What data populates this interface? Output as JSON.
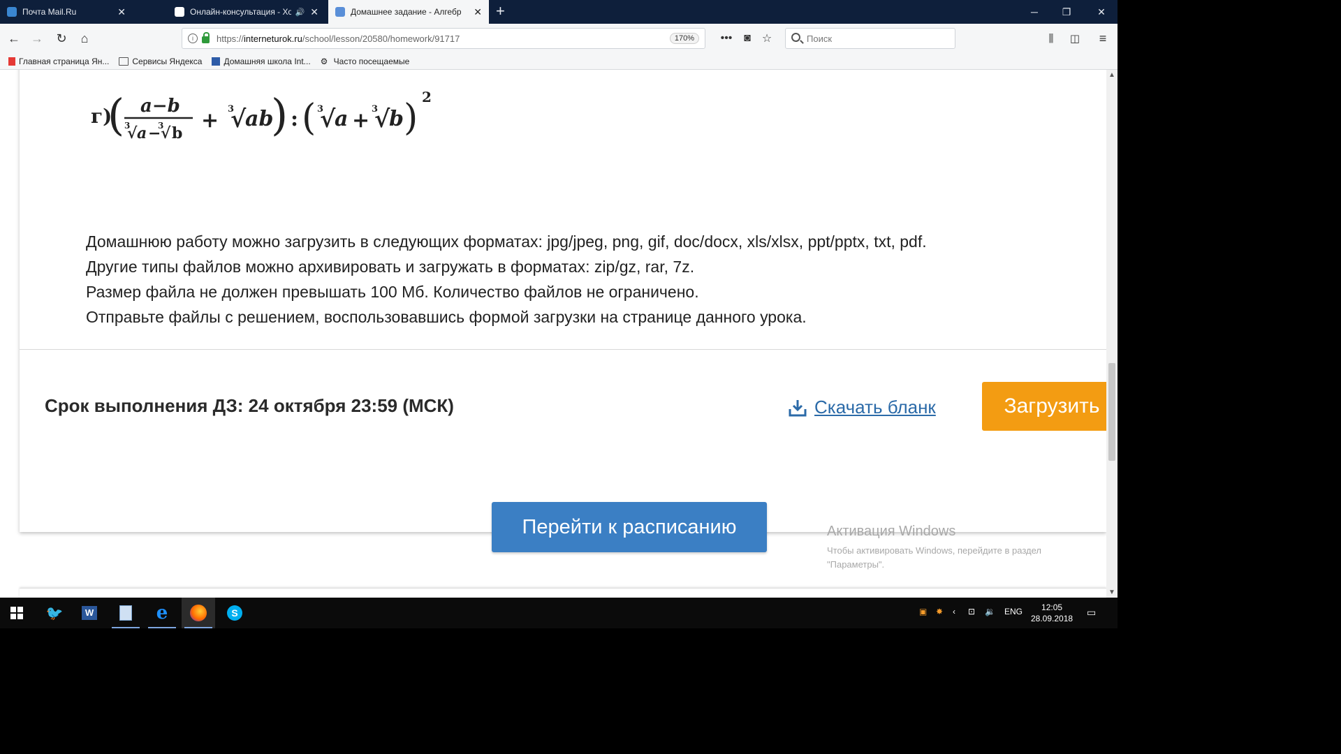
{
  "tabs": [
    {
      "title": "Почта Mail.Ru",
      "color": "#3a86d1"
    },
    {
      "title": "Онлайн-консультация - Хо",
      "color": "#ffffff"
    },
    {
      "title": "Домашнее задание - Алгебр",
      "color": "#5a8fd8"
    }
  ],
  "address": {
    "scheme": "https://",
    "host": "interneturok.ru",
    "path": "/school/lesson/20580/homework/91717",
    "zoom": "170%"
  },
  "search": {
    "placeholder": "Поиск"
  },
  "bookmarks": [
    {
      "label": "Главная страница Ян...",
      "icon": "yandex-icon"
    },
    {
      "label": "Сервисы Яндекса",
      "icon": "folder-icon"
    },
    {
      "label": "Домашняя школа Int...",
      "icon": "bookmark-icon"
    },
    {
      "label": "Часто посещаемые",
      "icon": "gear-icon"
    }
  ],
  "task": {
    "label": "г)",
    "formula": {
      "num": "a−b",
      "root_index": "3",
      "rad_a": "a",
      "rad_b": "b",
      "rad_ab": "ab",
      "exponent": "2"
    }
  },
  "rules": [
    "Домашнюю работу можно загрузить в следующих форматах: jpg/jpeg, png, gif, doc/docx, xls/xlsx, ppt/pptx, txt, pdf.",
    "Другие типы файлов можно архивировать и загружать в форматах: zip/gz, rar, 7z.",
    "Размер файла не должен превышать 100 Мб. Количество файлов не ограничено.",
    "Отправьте файлы с решением, воспользовавшись формой загрузки на странице данного урока."
  ],
  "deadline": "Срок выполнения ДЗ: 24 октября 23:59 (МСК)",
  "download_label": "Скачать бланк",
  "upload_label": "Загрузить",
  "schedule_label": "Перейти к расписанию",
  "activation": {
    "title": "Активация Windows",
    "text": "Чтобы активировать Windows, перейдите в раздел \"Параметры\"."
  },
  "taskbar": {
    "lang": "ENG",
    "time": "12:05",
    "date": "28.09.2018"
  },
  "colors": {
    "accent_orange": "#f39c12",
    "accent_blue": "#3b7fc4",
    "link": "#2b6aa8"
  }
}
